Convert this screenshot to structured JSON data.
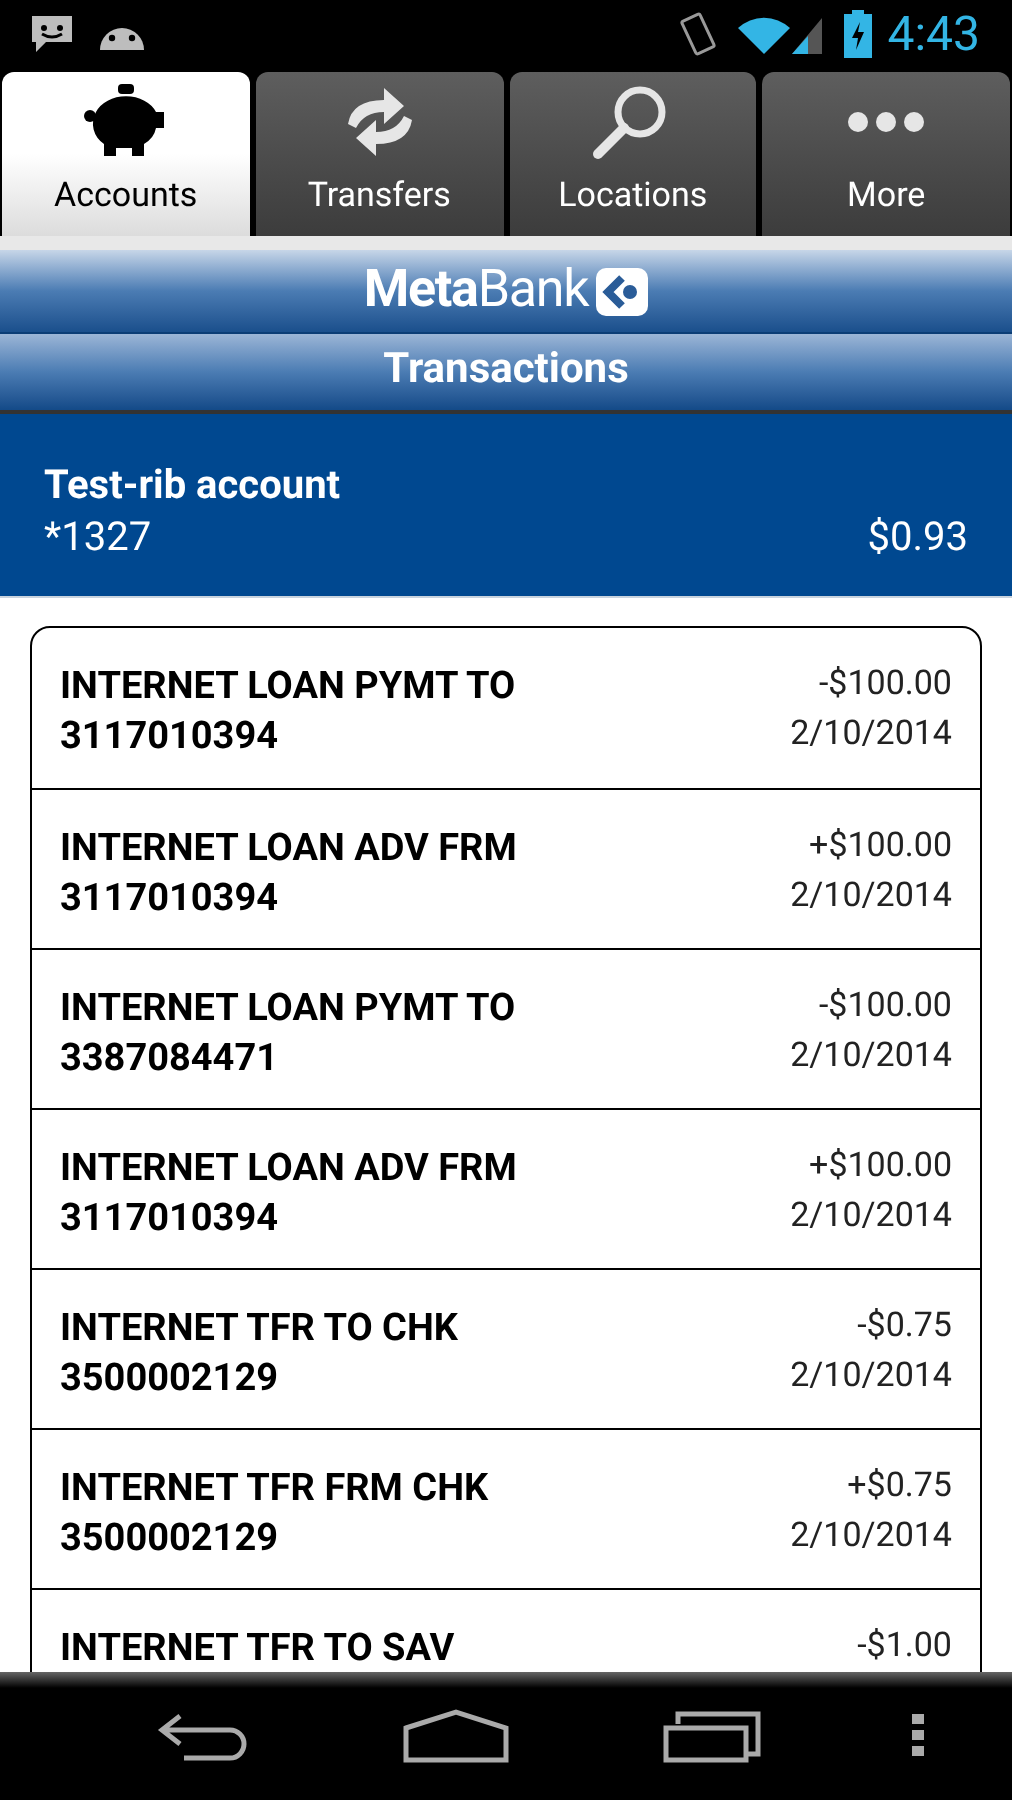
{
  "status_bar": {
    "time": "4:43"
  },
  "tabs": [
    {
      "label": "Accounts",
      "kind": "piggy",
      "selected": true
    },
    {
      "label": "Transfers",
      "kind": "sync",
      "selected": false
    },
    {
      "label": "Locations",
      "kind": "search",
      "selected": false
    },
    {
      "label": "More",
      "kind": "more",
      "selected": false
    }
  ],
  "logo": {
    "text": "**Meta**Bank"
  },
  "header": {
    "title": "Transactions"
  },
  "account": {
    "name": "Test-rib account",
    "number": "*1327",
    "balance": "$0.93"
  },
  "transactions": [
    {
      "description": "INTERNET LOAN PYMT TO",
      "reference": "3117010394",
      "amount": "-$100.00",
      "date": "2/10/2014"
    },
    {
      "description": "INTERNET LOAN ADV FRM",
      "reference": "3117010394",
      "amount": "+$100.00",
      "date": "2/10/2014"
    },
    {
      "description": "INTERNET LOAN PYMT TO",
      "reference": "3387084471",
      "amount": "-$100.00",
      "date": "2/10/2014"
    },
    {
      "description": "INTERNET LOAN ADV FRM",
      "reference": "3117010394",
      "amount": "+$100.00",
      "date": "2/10/2014"
    },
    {
      "description": "INTERNET TFR TO CHK",
      "reference": "3500002129",
      "amount": "-$0.75",
      "date": "2/10/2014"
    },
    {
      "description": "INTERNET TFR FRM CHK",
      "reference": "3500002129",
      "amount": "+$0.75",
      "date": "2/10/2014"
    },
    {
      "description": "INTERNET TFR TO SAV",
      "amount": "-$1.00"
    }
  ]
}
